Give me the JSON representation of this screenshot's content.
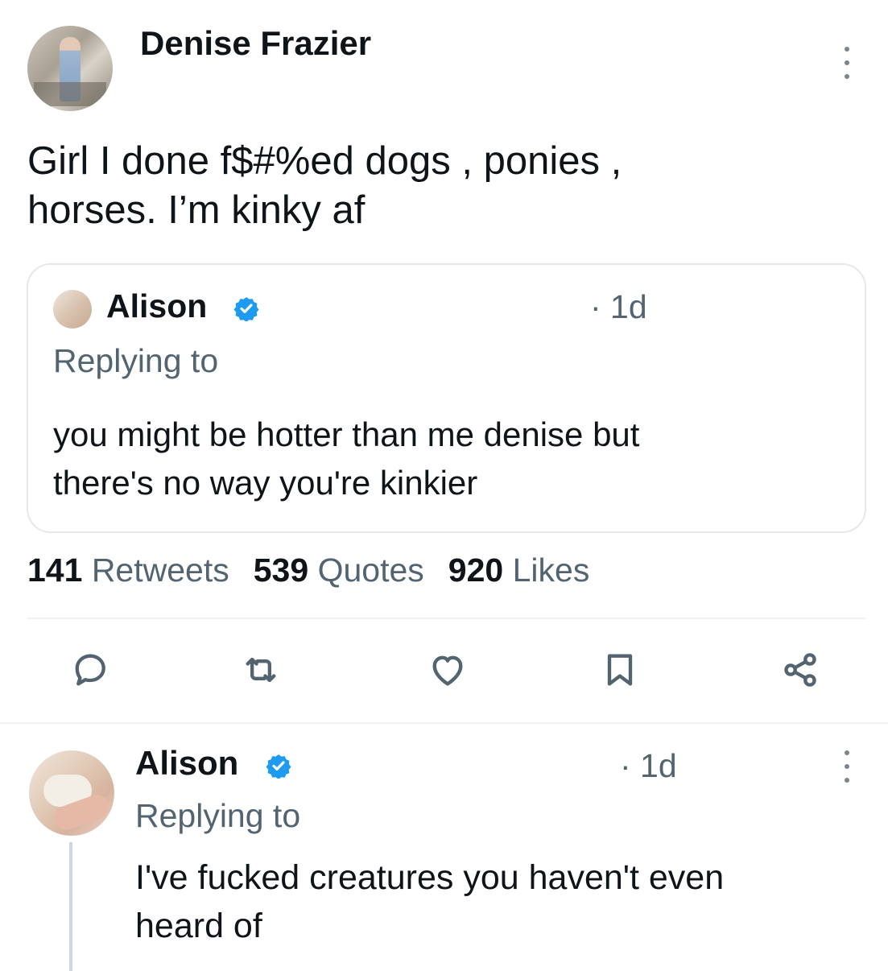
{
  "main_tweet": {
    "author_name": "Denise Frazier",
    "text_line1": "Girl I done f$#%ed dogs , ponies ,",
    "text_line2": "horses. I’m kinky af"
  },
  "quoted_tweet": {
    "author_name": "Alison",
    "time": "· 1d",
    "replying_to": "Replying to",
    "text_line1": "you might be hotter than me denise but",
    "text_line2": "there's no way you're kinkier"
  },
  "stats": {
    "retweets_count": "141",
    "retweets_label": "Retweets",
    "quotes_count": "539",
    "quotes_label": "Quotes",
    "likes_count": "920",
    "likes_label": "Likes"
  },
  "actions": [
    "reply-icon",
    "retweet-icon",
    "heart-icon",
    "bookmark-icon",
    "share-icon"
  ],
  "reply_tweet": {
    "author_name": "Alison",
    "time": "· 1d",
    "replying_to": "Replying to",
    "text_line1": "I've fucked creatures you haven't even",
    "text_line2": "heard of"
  },
  "colors": {
    "text": "#0f1419",
    "secondary": "#536471",
    "verified": "#1d9bf0",
    "border": "#e6e9ec"
  }
}
